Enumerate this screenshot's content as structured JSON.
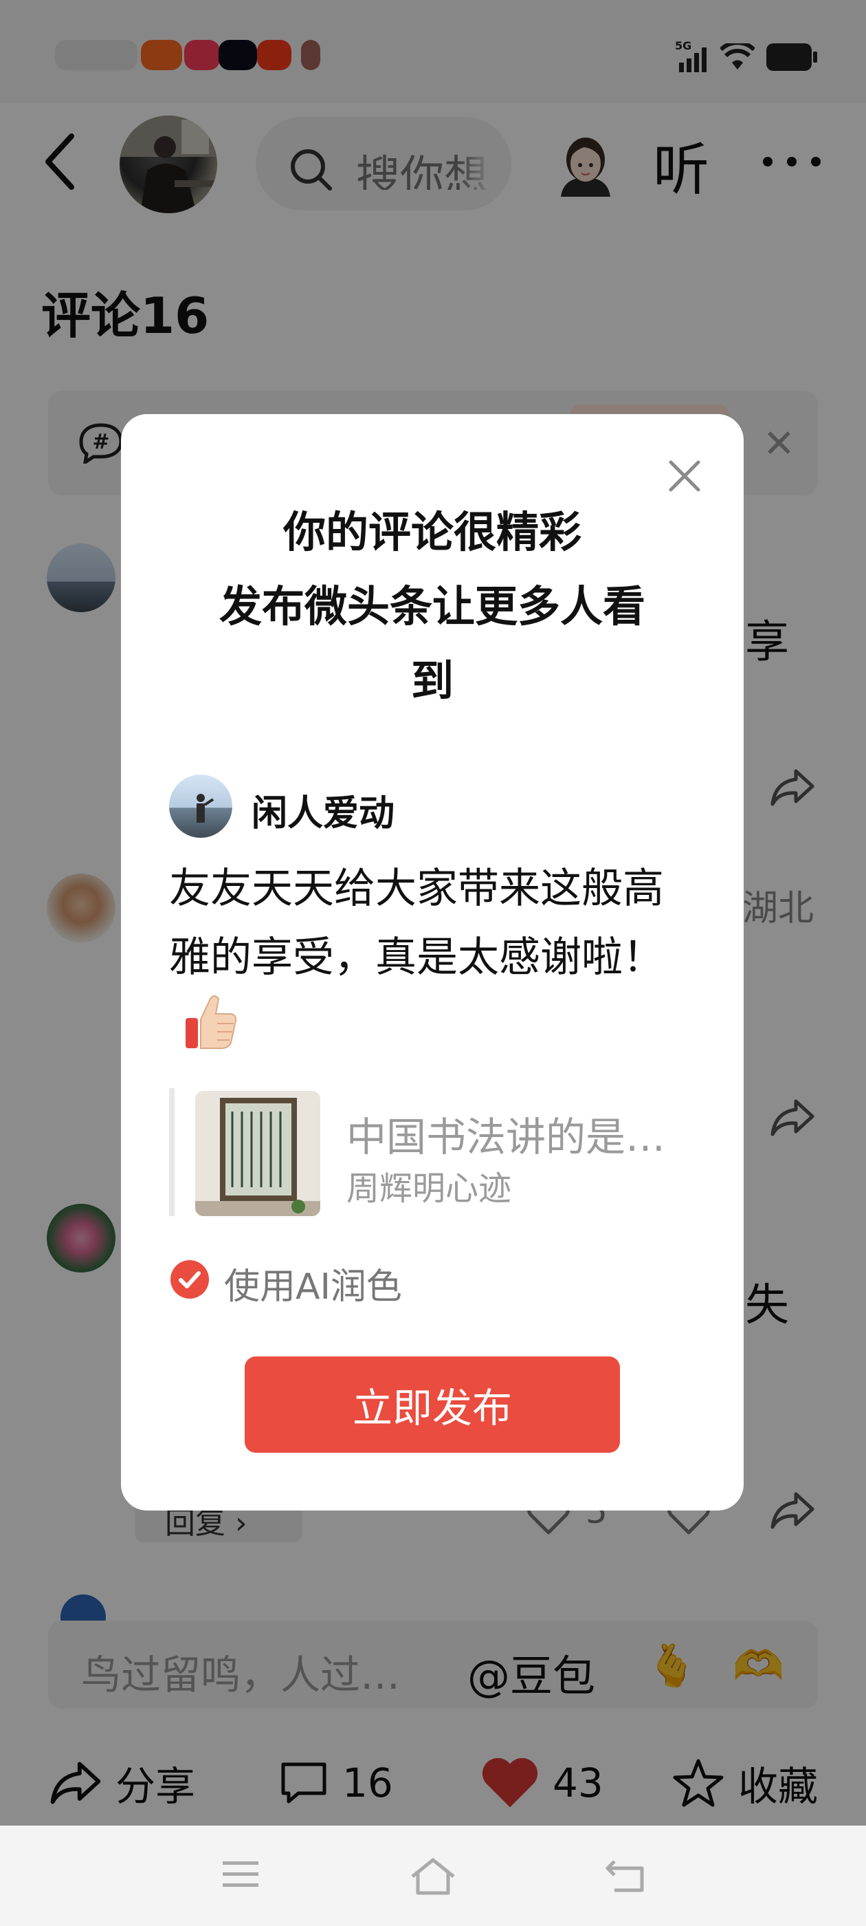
{
  "header": {
    "search_placeholder": "搜你想",
    "listen_label": "听"
  },
  "comments": {
    "title": "评论16",
    "side_snippets": [
      "享",
      "湖北",
      "失"
    ],
    "reply_label": "回复 ›",
    "like_count": "5"
  },
  "composer": {
    "placeholder": "鸟过留鸣，人过…",
    "mention": "@豆包",
    "emoji_1": "🫰",
    "emoji_2": "🫶"
  },
  "actions": {
    "share_label": "分享",
    "comment_count": "16",
    "like_count": "43",
    "favorite_label": "收藏"
  },
  "modal": {
    "title_line1": "你的评论很精彩",
    "title_line2": "发布微头条让更多人看",
    "title_line3": "到",
    "commenter_name": "闲人爱动",
    "comment_text": "友友天天给大家带来这般高雅的享受，真是太感谢啦！",
    "quote_title": "中国书法讲的是…",
    "quote_source": "周辉明心迹",
    "ai_polish_label": "使用AI润色",
    "ai_polish_checked": true,
    "publish_button": "立即发布"
  },
  "colors": {
    "accent_red": "#ea4c3f",
    "heart_red": "#d93a35",
    "overlay": "rgba(0,0,0,0.45)"
  },
  "icons": [
    "back-icon",
    "search-icon",
    "ai-assistant-avatar",
    "more-icon",
    "topic-icon",
    "close-icon",
    "share-icon",
    "heart-icon",
    "comment-icon",
    "star-icon",
    "menu-icon",
    "home-icon",
    "back-nav-icon",
    "check-icon",
    "thumbs-up-icon"
  ]
}
